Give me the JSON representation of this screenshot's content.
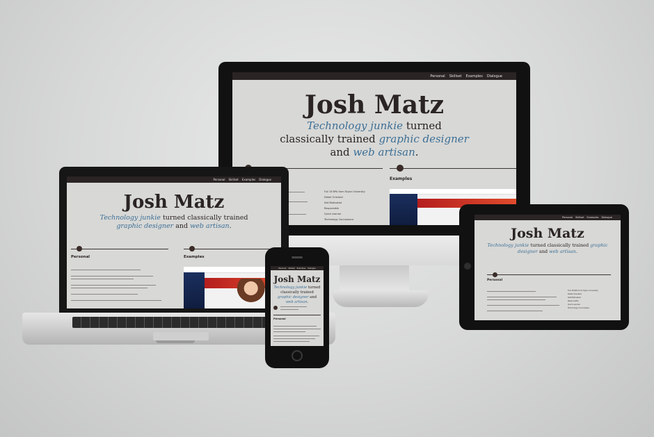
{
  "site": {
    "nav": [
      "Personal",
      "Skillset",
      "Examples",
      "Dialogue"
    ],
    "name": "Josh Matz",
    "tagline": {
      "hl1": "Technology junkie",
      "mid": " turned classically trained ",
      "hl2": "graphic designer",
      "and": " and ",
      "hl3": "web artisan",
      "end": "."
    },
    "sections": {
      "personal": "Personal",
      "examples": "Examples"
    },
    "bullets": [
      "Full 18 RPA from Taylor University",
      "Detail Oriented",
      "Self-Motivated",
      "Responsible",
      "Quick Learner",
      "Technology Connoisseur"
    ]
  },
  "colors": {
    "accent_blue": "#3c6f96",
    "nav_bg": "#2a2424",
    "site_bg": "#d8d8d6"
  }
}
